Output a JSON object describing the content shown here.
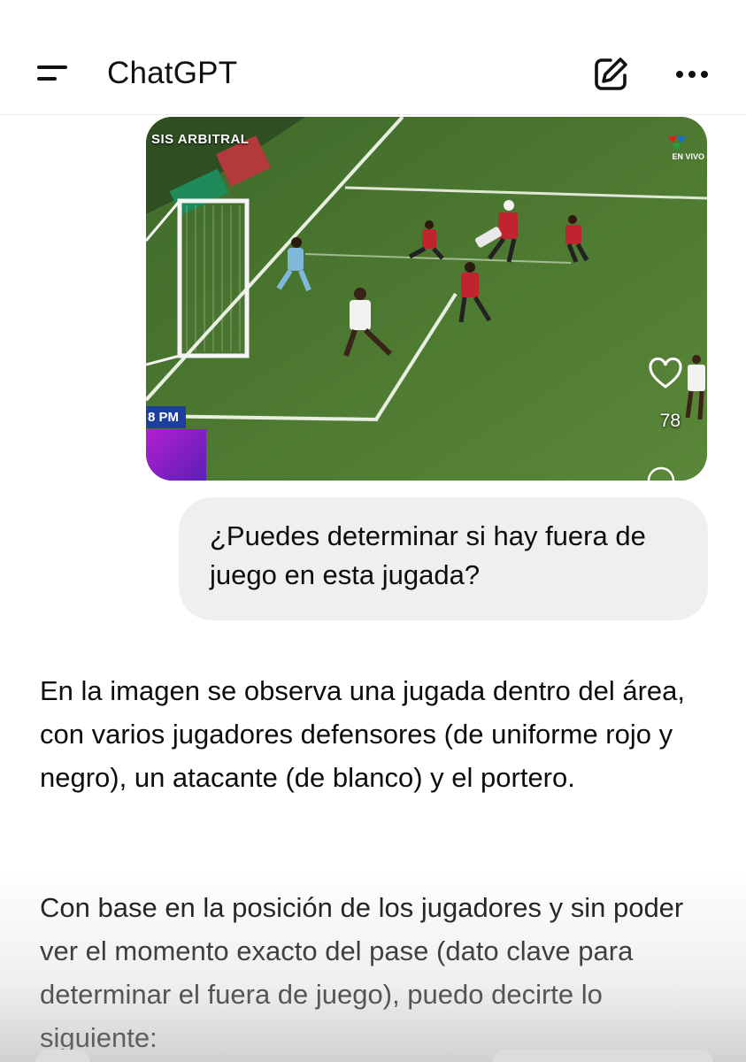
{
  "header": {
    "title": "ChatGPT",
    "menu_icon": "menu-icon",
    "edit_icon": "edit-icon",
    "more_icon": "more-icon"
  },
  "image": {
    "broadcast_label": "SIS ARBITRAL",
    "live_label": "EN VIVO",
    "time_label": "8 PM",
    "like_count": "78",
    "heart_icon": "heart-icon"
  },
  "user_message": {
    "text": "¿Puedes determinar si hay fuera de juego en esta jugada?"
  },
  "assistant_message": {
    "paragraph1": "En la imagen se observa una jugada dentro del área, con varios jugadores defensores (de uniforme rojo y negro), un atacante (de blanco) y el portero.",
    "paragraph2": "Con base en la posición de los jugadores y sin poder ver el momento exacto del pase (dato clave para determinar el fuera de juego), puedo decirte lo siguiente:"
  },
  "colors": {
    "pitch": "#4f7a33",
    "bubble": "#efefef",
    "text": "#0d0d0d"
  }
}
